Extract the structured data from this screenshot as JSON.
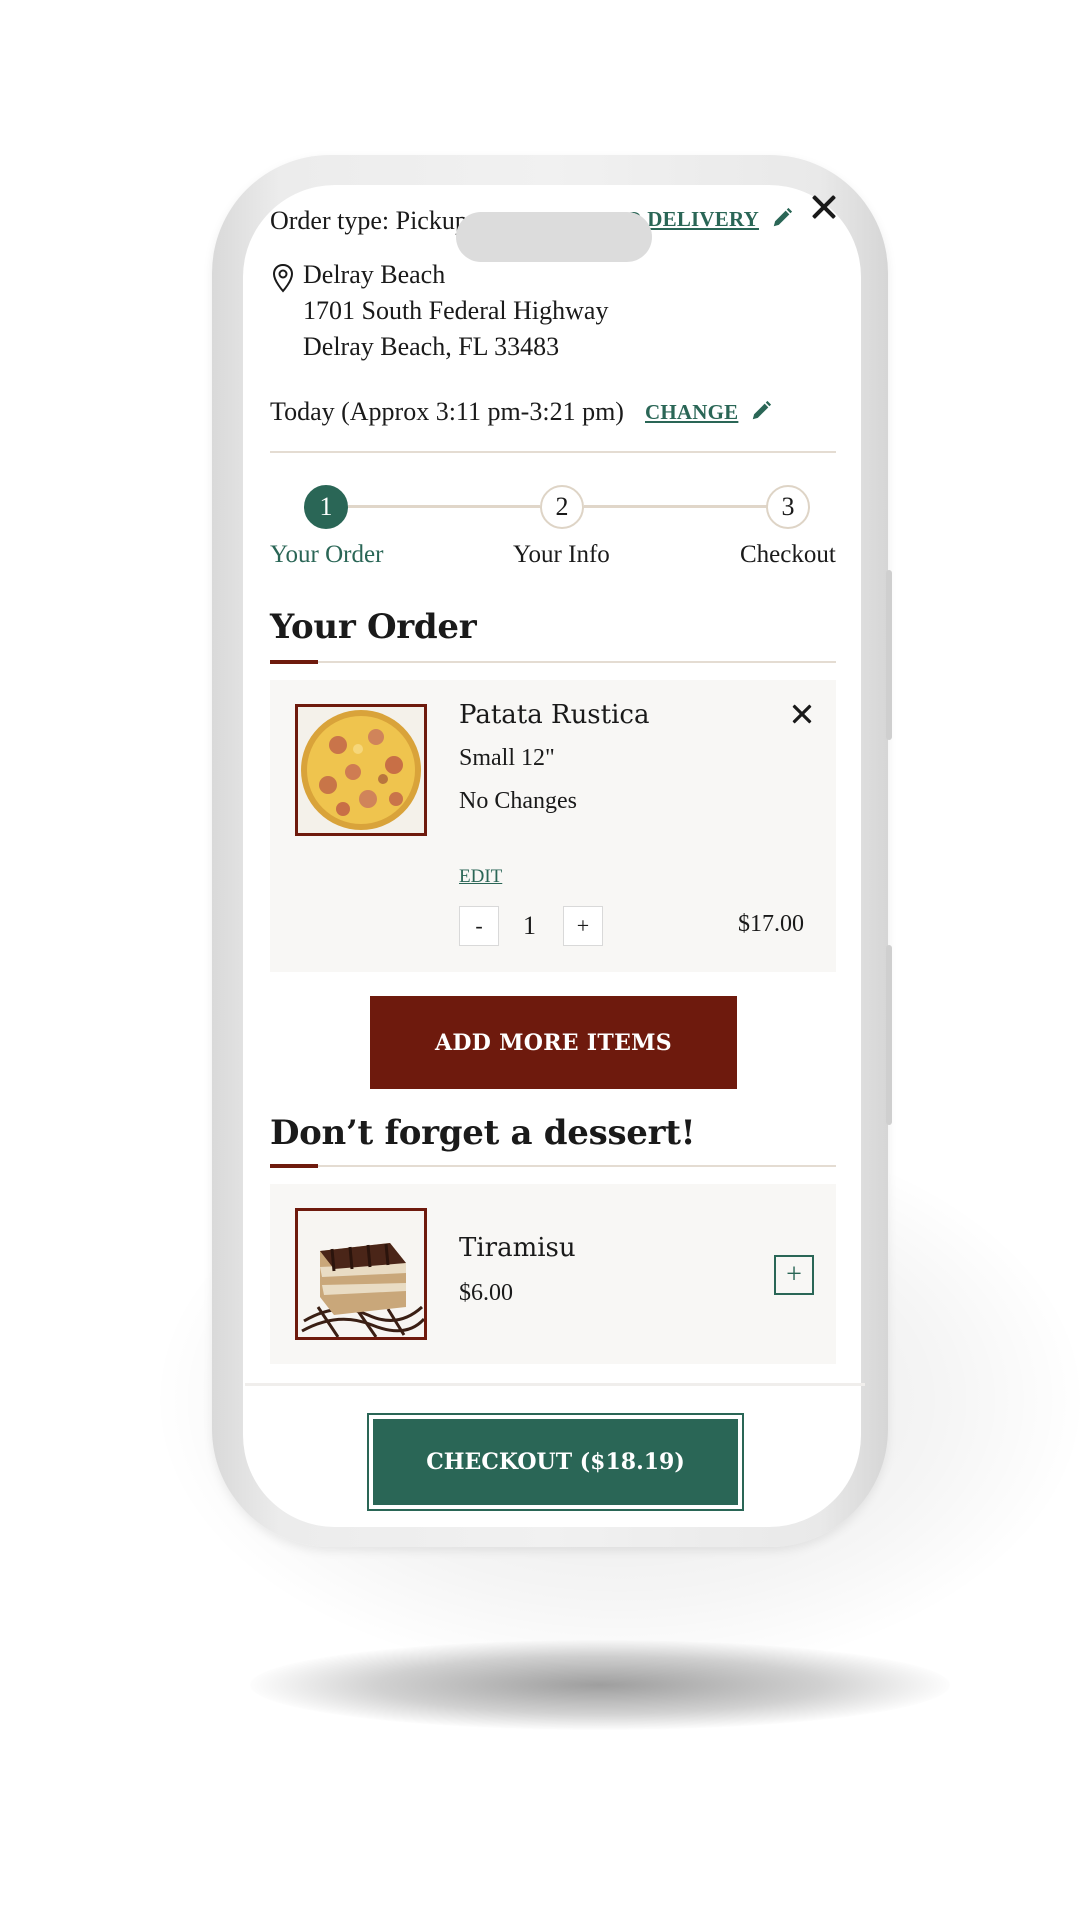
{
  "order": {
    "type_text": "Order type: Pickup",
    "change_type_label": "CHANGE TO DELIVERY",
    "location_name": "Delray Beach",
    "address_line1": "1701 South Federal Highway",
    "address_line2": "Delray Beach, FL 33483",
    "time_text": "Today (Approx 3:11 pm-3:21 pm)",
    "change_time_label": "CHANGE"
  },
  "steps": [
    {
      "number": "1",
      "label": "Your Order",
      "active": true
    },
    {
      "number": "2",
      "label": "Your Info",
      "active": false
    },
    {
      "number": "3",
      "label": "Checkout",
      "active": false
    }
  ],
  "your_order": {
    "title": "Your Order",
    "item": {
      "name": "Patata Rustica",
      "size": "Small 12\"",
      "modifiers": "No Changes",
      "edit_label": "EDIT",
      "minus_label": "-",
      "quantity": "1",
      "plus_label": "+",
      "price": "$17.00"
    },
    "add_more_label": "ADD MORE ITEMS"
  },
  "dessert": {
    "title": "Don’t forget a dessert!",
    "item": {
      "name": "Tiramisu",
      "price": "$6.00",
      "add_label": "+"
    }
  },
  "checkout": {
    "label": "CHECKOUT ($18.19)"
  },
  "colors": {
    "brand_green": "#2a6656",
    "brand_red": "#6e1a0d",
    "card_bg": "#f8f7f5"
  },
  "icons": [
    "close-icon",
    "pencil-icon",
    "location-pin-icon",
    "remove-item-icon"
  ]
}
